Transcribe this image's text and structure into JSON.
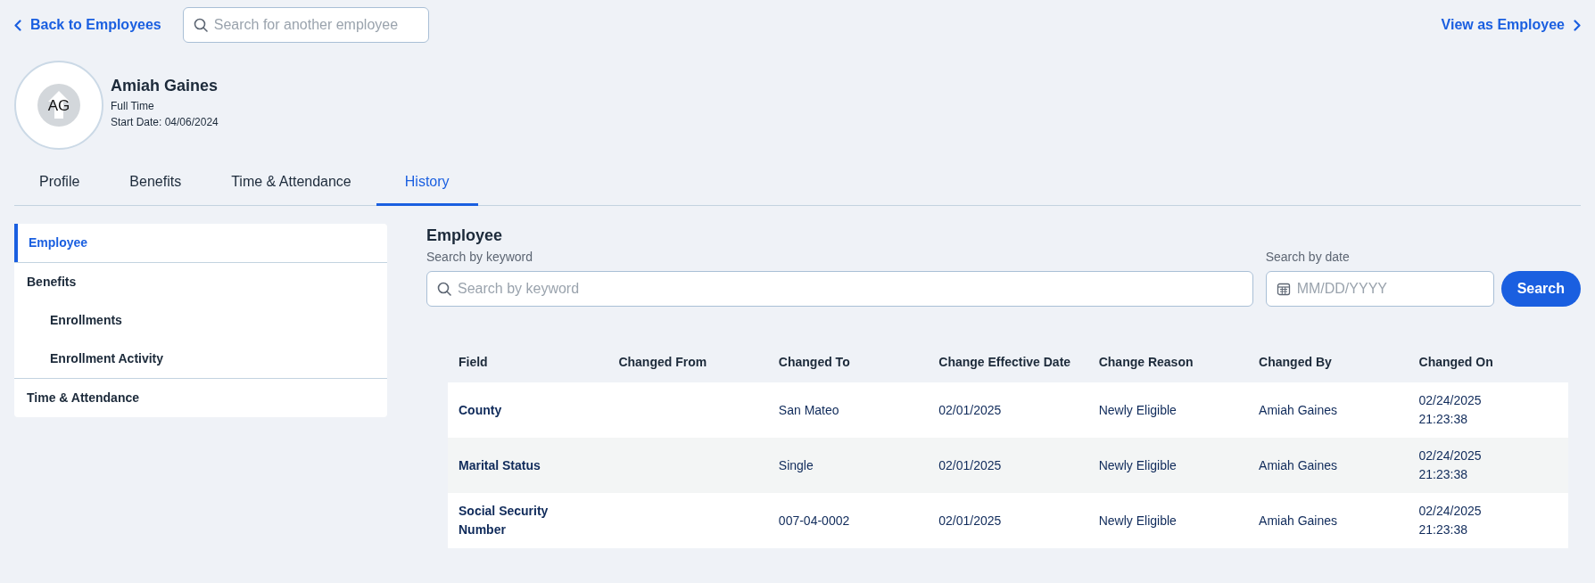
{
  "top_bar": {
    "back_link": "Back to Employees",
    "employee_search": {
      "placeholder": "Search for another employee"
    },
    "view_as_link": "View as Employee"
  },
  "employee": {
    "initials": "AG",
    "name": "Amiah Gaines",
    "employment_type": "Full Time",
    "start_date": "Start Date: 04/06/2024"
  },
  "tabs": [
    {
      "label": "Profile",
      "selected": false
    },
    {
      "label": "Benefits",
      "selected": false
    },
    {
      "label": "Time & Attendance",
      "selected": false
    },
    {
      "label": "History",
      "selected": true
    }
  ],
  "sidebar": {
    "items": [
      {
        "label": "Employee",
        "selected": true
      },
      {
        "label": "Benefits",
        "selected": false,
        "children": [
          {
            "label": "Enrollments",
            "selected": false
          },
          {
            "label": "Enrollment Activity",
            "selected": false
          }
        ]
      },
      {
        "label": "Time & Attendance",
        "selected": false
      }
    ]
  },
  "history": {
    "title": "Employee",
    "keyword_search": {
      "label": "Search by keyword",
      "placeholder": "Search by keyword"
    },
    "date_search": {
      "label": "Search by date",
      "placeholder": "MM/DD/YYYY"
    },
    "search_button": "Search",
    "table": {
      "columns": [
        "Field",
        "Changed From",
        "Changed To",
        "Change Effective Date",
        "Change Reason",
        "Changed By",
        "Changed On"
      ],
      "rows": [
        {
          "field": "County",
          "changed_to": "San Mateo",
          "effective_date": "02/01/2025",
          "reason": "Newly Eligible",
          "changed_by": "Amiah Gaines",
          "changed_on": "02/24/2025 21:23:38"
        },
        {
          "field": "Marital Status",
          "changed_to": "Single",
          "effective_date": "02/01/2025",
          "reason": "Newly Eligible",
          "changed_by": "Amiah Gaines",
          "changed_on": "02/24/2025 21:23:38"
        },
        {
          "field": "Social Security Number",
          "changed_to": "007-04-0002",
          "effective_date": "02/01/2025",
          "reason": "Newly Eligible",
          "changed_by": "Amiah Gaines",
          "changed_on": "02/24/2025 21:23:38"
        }
      ]
    }
  }
}
